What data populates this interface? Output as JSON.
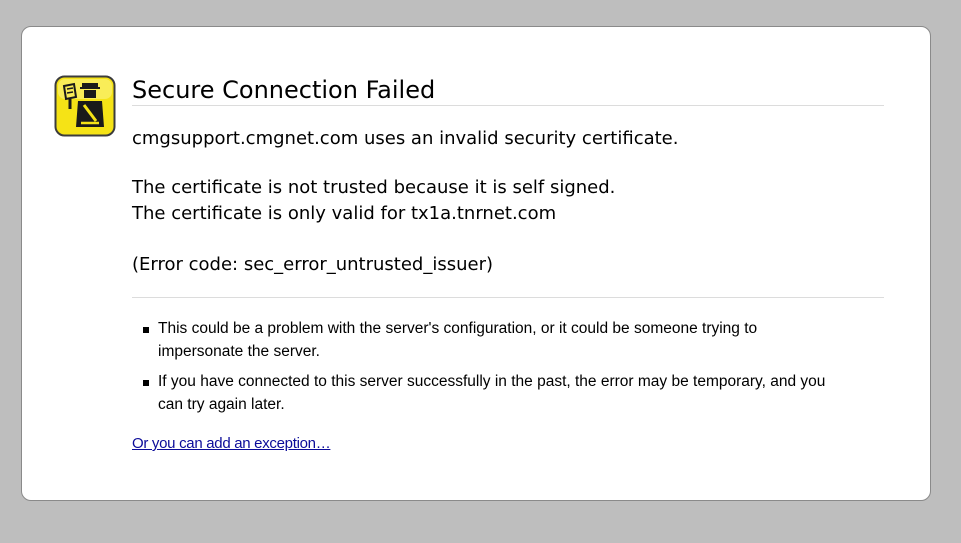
{
  "page": {
    "title": "Secure Connection Failed",
    "short_description": "cmgsupport.cmgnet.com uses an invalid security certificate.",
    "details": [
      "The certificate is not trusted because it is self signed.",
      "The certificate is only valid for tx1a.tnrnet.com",
      "(Error code: sec_error_untrusted_issuer)"
    ],
    "bullets": [
      "This could be a problem with the server's configuration, or it could be someone trying to impersonate the server.",
      "If you have connected to this server successfully in the past, the error may be temporary, and you can try again later."
    ],
    "exception_link": "Or you can add an exception…"
  },
  "icon": {
    "name": "security-officer-icon",
    "colors": {
      "fill": "#f5e316",
      "border": "#3c3c3c",
      "glyph": "#1a1a1a"
    }
  },
  "colors": {
    "background": "#bebebe",
    "panel": "#ffffff",
    "panel_border": "#8a8a8a",
    "link": "#0b0b99",
    "separator": "#dcdcdc"
  }
}
